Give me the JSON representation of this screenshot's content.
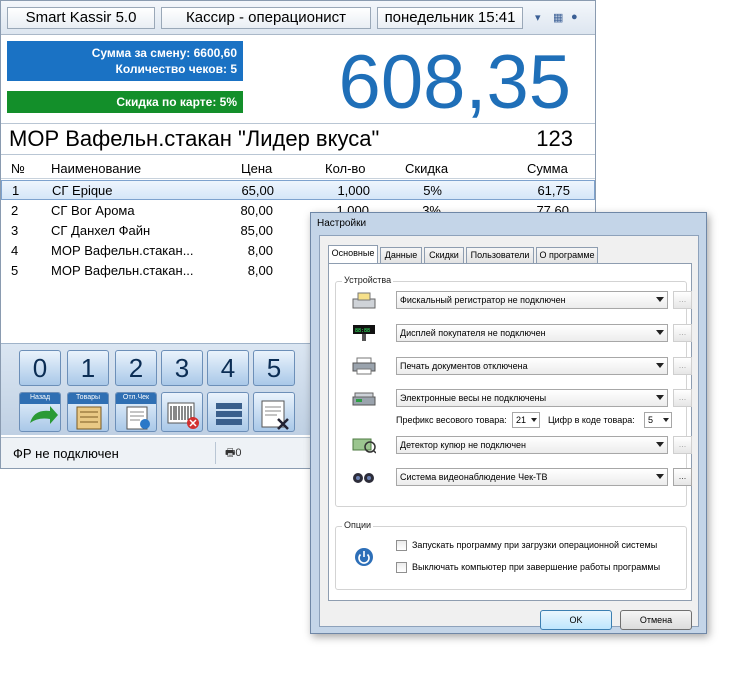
{
  "main": {
    "app_title": "Smart Kassir 5.0",
    "role": "Кассир - операционист",
    "datetime": "понедельник 15:41",
    "shift_sum": "Сумма за смену: 6600,60",
    "check_count": "Количество чеков: 5",
    "card_discount": "Скидка по карте: 5%",
    "total": "608,35",
    "product_name": "МОР Вафельн.стакан \"Лидер вкуса\"",
    "product_code": "123",
    "table": {
      "headers": [
        "№",
        "Наименование",
        "Цена",
        "Кол-во",
        "Скидка",
        "Сумма"
      ],
      "rows": [
        [
          "1",
          "СГ Epique",
          "65,00",
          "1,000",
          "5%",
          "61,75"
        ],
        [
          "2",
          "СГ Вог Арома",
          "80,00",
          "1,000",
          "3%",
          "77,60"
        ],
        [
          "3",
          "СГ Данхел Файн",
          "85,00",
          "",
          "",
          ""
        ],
        [
          "4",
          "МОР Вафельн.стакан...",
          "8,00",
          "",
          "",
          ""
        ],
        [
          "5",
          "МОР Вафельн.стакан...",
          "8,00",
          "",
          "",
          ""
        ]
      ]
    },
    "numkeys": [
      "0",
      "1",
      "2",
      "3",
      "4",
      "5"
    ],
    "funckeys": [
      {
        "label": "Назад",
        "icon": "back-arrow-icon"
      },
      {
        "label": "Товары",
        "icon": "goods-icon"
      },
      {
        "label": "Отл.Чек",
        "icon": "deferred-check-icon"
      },
      {
        "label": "",
        "icon": "barcode-delete-icon"
      },
      {
        "label": "",
        "icon": "stack-icon"
      },
      {
        "label": "",
        "icon": "document-cancel-icon"
      }
    ],
    "status": "ФР не подключен",
    "status_counter": "0",
    "ghost_total": "608"
  },
  "dialog": {
    "title": "Настройки",
    "tabs": [
      "Основные",
      "Данные",
      "Скидки",
      "Пользователи",
      "О программе"
    ],
    "active_tab": "Основные",
    "devices_group": "Устройства",
    "devices": [
      {
        "icon": "fiscal-register-icon",
        "value": "Фискальный регистратор не подключен",
        "dots_enabled": false
      },
      {
        "icon": "customer-display-icon",
        "value": "Дисплей покупателя не подключен",
        "dots_enabled": false
      },
      {
        "icon": "printer-icon",
        "value": "Печать документов отключена",
        "dots_enabled": false
      },
      {
        "icon": "scales-icon",
        "value": "Электронные весы не подключены",
        "dots_enabled": false
      },
      {
        "icon": "bill-detector-icon",
        "value": "Детектор купюр не подключен",
        "dots_enabled": false
      },
      {
        "icon": "cctv-icon",
        "value": "Система видеонаблюдение Чек-ТВ",
        "dots_enabled": true
      }
    ],
    "weight_prefix_label": "Префикс весового товара:",
    "weight_prefix_value": "21",
    "digits_label": "Цифр в коде товара:",
    "digits_value": "5",
    "options_group": "Опции",
    "options": [
      {
        "label": "Запускать программу при загрузки операционной системы",
        "checked": false
      },
      {
        "label": "Выключать компьютер при завершение работы программы",
        "checked": false
      }
    ],
    "ok": "OK",
    "cancel": "Отмена",
    "dots": "..."
  },
  "colors": {
    "accent_blue": "#1a72c4",
    "total_blue": "#1f6fb8",
    "discount_green": "#138f2a"
  }
}
